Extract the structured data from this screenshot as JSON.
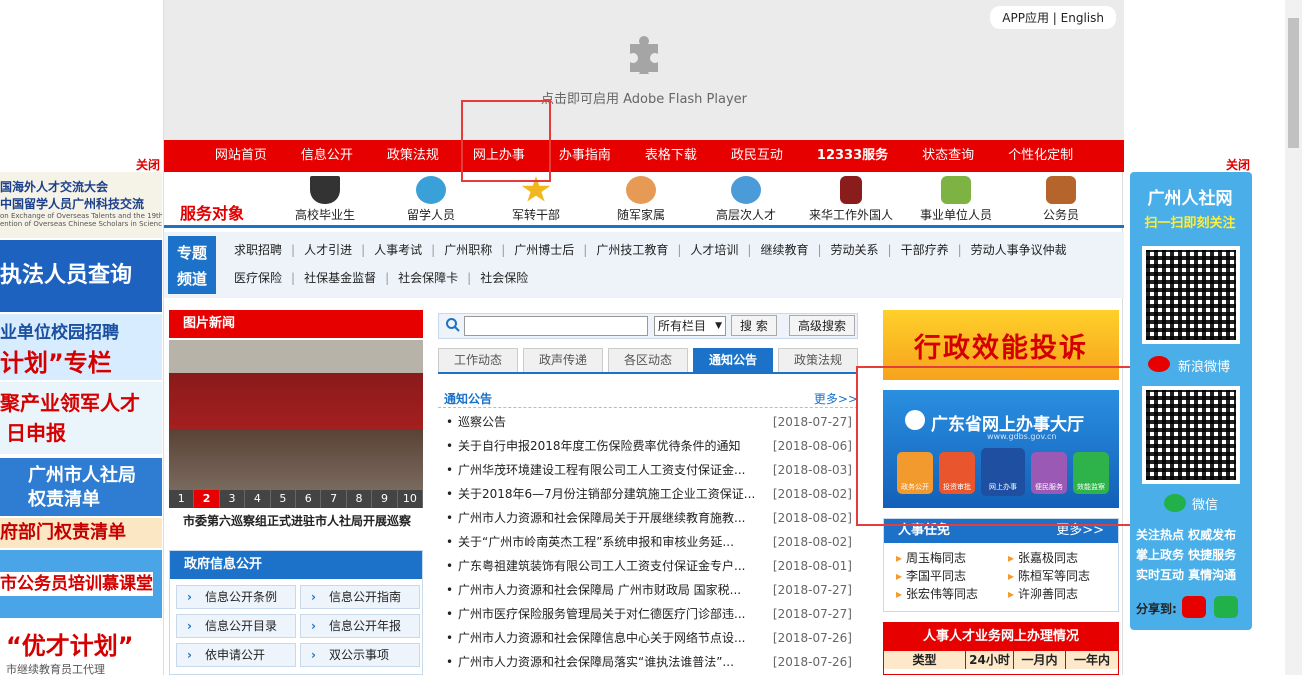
{
  "flash": {
    "hint": "点击即可启用 Adobe Flash Player"
  },
  "toplinks": {
    "app": "APP应用",
    "sep": "|",
    "english": "English"
  },
  "nav": [
    "网站首页",
    "信息公开",
    "政策法规",
    "网上办事",
    "办事指南",
    "表格下载",
    "政民互动",
    "12333服务",
    "状态查询",
    "个性化定制"
  ],
  "services": {
    "title": "服务对象",
    "items": [
      "高校毕业生",
      "留学人员",
      "军转干部",
      "随军家属",
      "高层次人才",
      "来华工作外国人",
      "事业单位人员",
      "公务员"
    ]
  },
  "topic": {
    "badge_line1": "专题",
    "badge_line2": "频道",
    "row1": [
      "求职招聘",
      "人才引进",
      "人事考试",
      "广州职称",
      "广州博士后",
      "广州技工教育",
      "人才培训",
      "继续教育",
      "劳动关系",
      "干部疗养",
      "劳动人事争议仲裁"
    ],
    "row2": [
      "医疗保险",
      "社保基金监督",
      "社会保障卡",
      "社会保险"
    ]
  },
  "photo_news": {
    "title": "图片新闻",
    "caption": "市委第六巡察组正式进驻市人社局开展巡察",
    "pages": [
      "1",
      "2",
      "3",
      "4",
      "5",
      "6",
      "7",
      "8",
      "9",
      "10"
    ],
    "active_page": "2"
  },
  "search": {
    "scope": "所有栏目",
    "search_btn": "搜 索",
    "advanced_btn": "高级搜索"
  },
  "tabs": [
    "工作动态",
    "政声传递",
    "各区动态",
    "通知公告",
    "政策法规"
  ],
  "active_tab": "通知公告",
  "notices": {
    "heading": "通知公告",
    "more": "更多>>",
    "items": [
      {
        "title": "巡察公告",
        "date": "[2018-07-27]"
      },
      {
        "title": "关于自行申报2018年度工伤保险费率优待条件的通知",
        "date": "[2018-08-06]"
      },
      {
        "title": "广州华茂环境建设工程有限公司工人工资支付保证金...",
        "date": "[2018-08-03]"
      },
      {
        "title": "关于2018年6—7月份注销部分建筑施工企业工资保证...",
        "date": "[2018-08-02]"
      },
      {
        "title": "广州市人力资源和社会保障局关于开展继续教育施教...",
        "date": "[2018-08-02]"
      },
      {
        "title": "关于“广州市岭南英杰工程”系统申报和审核业务延...",
        "date": "[2018-08-02]"
      },
      {
        "title": "广东粤祖建筑装饰有限公司工人工资支付保证金专户...",
        "date": "[2018-08-01]"
      },
      {
        "title": "广州市人力资源和社会保障局 广州市财政局 国家税...",
        "date": "[2018-07-27]"
      },
      {
        "title": "广州市医疗保险服务管理局关于对仁德医疗门诊部违...",
        "date": "[2018-07-27]"
      },
      {
        "title": "广州市人力资源和社会保障信息中心关于网络节点设...",
        "date": "[2018-07-26]"
      },
      {
        "title": "广州市人力资源和社会保障局落实“谁执法谁普法”...",
        "date": "[2018-07-26]"
      }
    ]
  },
  "gov_info": {
    "title": "政府信息公开",
    "buttons": [
      "信息公开条例",
      "信息公开指南",
      "信息公开目录",
      "信息公开年报",
      "依申请公开",
      "双公示事项"
    ]
  },
  "right_col": {
    "banner1": "行政效能投诉",
    "banner2_title": "广东省网上办事大厅",
    "banner2_url": "www.gdbs.gov.cn",
    "banner2_icons": [
      "政务公开",
      "投资审批",
      "网上办事",
      "便民服务",
      "效能监察"
    ],
    "appointments_title": "人事任免",
    "appointments_more": "更多>>",
    "appointments": [
      "周玉梅同志",
      "张嘉极同志",
      "李国平同志",
      "陈桓军等同志",
      "张宏伟等同志",
      "许泖善同志"
    ],
    "stats_title": "人事人才业务网上办理情况",
    "stats_headers": [
      "类型",
      "24小时",
      "一月内",
      "一年内"
    ]
  },
  "left_float": {
    "close": "关闭",
    "b1_line1": "国海外人才交流大会",
    "b1_line2": "中国留学人员广州科技交流",
    "b1_line3": "on Exchange of Overseas Talents and the 19th",
    "b1_line4": "ention of Overseas Chinese Scholars in Science and",
    "b2": "执法人员查询",
    "b3_line1": "业单位校园招聘",
    "b3_line2": "计划”专栏",
    "b4_line1": "聚产业领军人才",
    "b4_line2": "日申报",
    "b5_line1": "广州市人社局",
    "b5_line2": "权责清单",
    "b6": "府部门权责清单",
    "b7": "市公务员培训慕课堂",
    "b8": "“优才计划”",
    "b8_sub": "市继续教育员工代理"
  },
  "right_float": {
    "close": "关闭",
    "title": "广州人社网",
    "subtitle": "扫一扫即刻关注",
    "weibo": "新浪微博",
    "wechat": "微信",
    "slogan1": "关注热点 权威发布",
    "slogan2": "掌上政务 快捷服务",
    "slogan3": "实时互动 真情沟通",
    "share": "分享到:"
  },
  "colors": {
    "brand_red": "#e60000",
    "brand_blue": "#1b72c8",
    "annotation_red": "#e63c3c"
  }
}
